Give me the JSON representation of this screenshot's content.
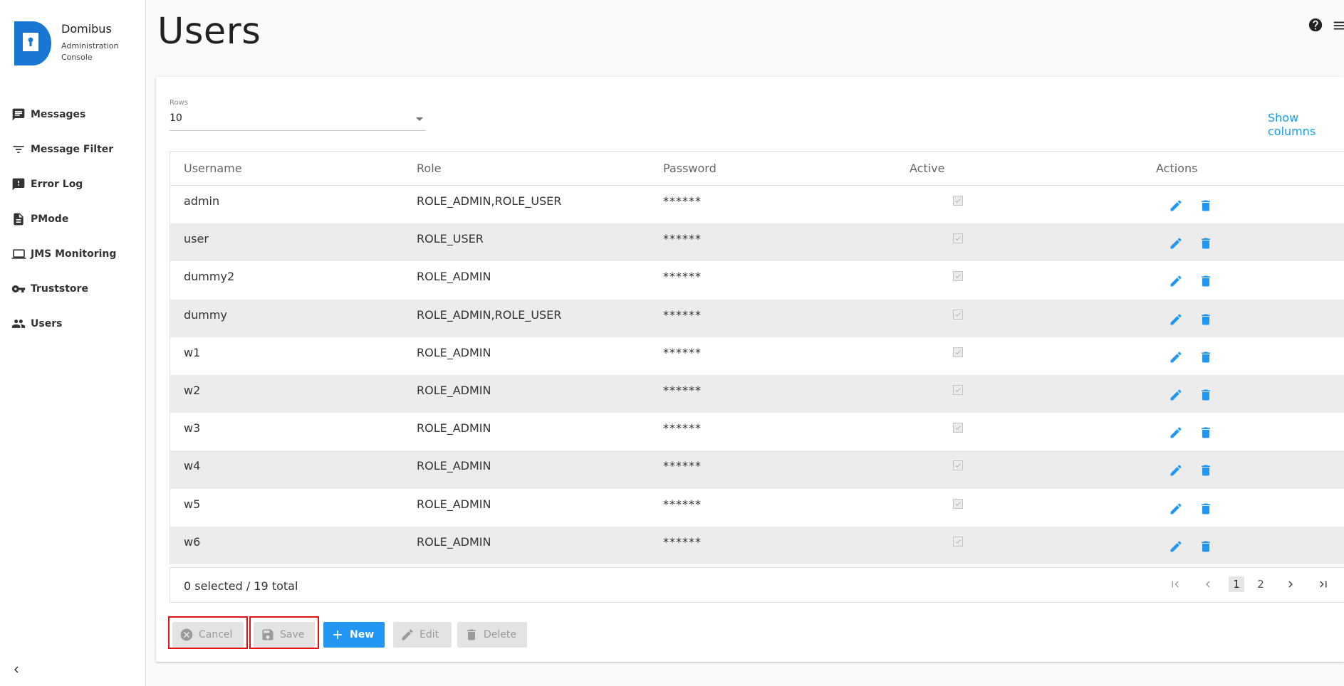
{
  "brand": {
    "name": "Domibus",
    "subtitle": "Administration Console",
    "logo_color": "#1976d2"
  },
  "sidebar": {
    "items": [
      {
        "label": "Messages",
        "icon": "message-icon"
      },
      {
        "label": "Message Filter",
        "icon": "filter-icon"
      },
      {
        "label": "Error Log",
        "icon": "error-log-icon"
      },
      {
        "label": "PMode",
        "icon": "document-icon"
      },
      {
        "label": "JMS Monitoring",
        "icon": "laptop-icon"
      },
      {
        "label": "Truststore",
        "icon": "key-icon"
      },
      {
        "label": "Users",
        "icon": "users-icon"
      }
    ],
    "collapse_icon": "chevron-left-icon"
  },
  "header": {
    "title": "Users",
    "help_icon": "help-icon",
    "menu_icon": "menu-icon"
  },
  "rows_selector": {
    "label": "Rows",
    "value": "10"
  },
  "show_columns_label": "Show columns",
  "table": {
    "columns": [
      "Username",
      "Role",
      "Password",
      "Active",
      "Actions"
    ],
    "rows": [
      {
        "username": "admin",
        "role": "ROLE_ADMIN,ROLE_USER",
        "password": "******",
        "active": true
      },
      {
        "username": "user",
        "role": "ROLE_USER",
        "password": "******",
        "active": true
      },
      {
        "username": "dummy2",
        "role": "ROLE_ADMIN",
        "password": "******",
        "active": true
      },
      {
        "username": "dummy",
        "role": "ROLE_ADMIN,ROLE_USER",
        "password": "******",
        "active": true
      },
      {
        "username": "w1",
        "role": "ROLE_ADMIN",
        "password": "******",
        "active": true
      },
      {
        "username": "w2",
        "role": "ROLE_ADMIN",
        "password": "******",
        "active": true
      },
      {
        "username": "w3",
        "role": "ROLE_ADMIN",
        "password": "******",
        "active": true
      },
      {
        "username": "w4",
        "role": "ROLE_ADMIN",
        "password": "******",
        "active": true
      },
      {
        "username": "w5",
        "role": "ROLE_ADMIN",
        "password": "******",
        "active": true
      },
      {
        "username": "w6",
        "role": "ROLE_ADMIN",
        "password": "******",
        "active": true
      }
    ],
    "summary": "0 selected / 19 total"
  },
  "pagination": {
    "pages": [
      "1",
      "2"
    ],
    "current": "1"
  },
  "buttons": {
    "cancel": "Cancel",
    "save": "Save",
    "new": "New",
    "edit": "Edit",
    "delete": "Delete"
  },
  "colors": {
    "accent": "#2196f3",
    "link": "#1a9ee0",
    "highlight": "#e01414"
  }
}
